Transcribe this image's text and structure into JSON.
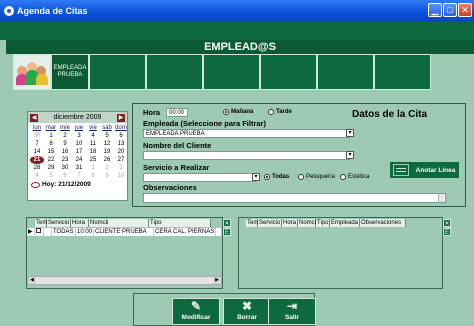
{
  "window": {
    "title": "Agenda de Citas",
    "controls": [
      "minimize",
      "maximize",
      "close"
    ]
  },
  "header": {
    "title": "EMPLEAD@S"
  },
  "thumbs": [
    {
      "kind": "people-icon"
    },
    {
      "label": "EMPLEADA PRUEBA"
    }
  ],
  "calendar": {
    "month": "diciembre 2009",
    "days_of_week": [
      "lun",
      "mar",
      "mié",
      "jue",
      "vie",
      "sáb",
      "dom"
    ],
    "weeks": [
      [
        "30",
        "1",
        "2",
        "3",
        "4",
        "5",
        "6"
      ],
      [
        "7",
        "8",
        "9",
        "10",
        "11",
        "12",
        "13"
      ],
      [
        "14",
        "15",
        "16",
        "17",
        "18",
        "19",
        "20"
      ],
      [
        "21",
        "22",
        "23",
        "24",
        "25",
        "26",
        "27"
      ],
      [
        "28",
        "29",
        "30",
        "31",
        "1",
        "2",
        "3"
      ],
      [
        "4",
        "5",
        "6",
        "7",
        "8",
        "9",
        "10"
      ]
    ],
    "selected_day": "21",
    "today_label": "Hoy: 21/12/2009"
  },
  "form": {
    "hora_label": "Hora",
    "hora_value": "00:00",
    "manana_label": "Mañana",
    "tarde_label": "Tarde",
    "section_title": "Datos de la Cita",
    "empleada_label": "Empleada (Seleccione para Filtrar)",
    "empleada_value": "EMPLEADA PRUEBA",
    "cliente_label": "Nombre del Cliente",
    "cliente_value": "",
    "servicio_label": "Servicio a Realizar",
    "servicio_value": "",
    "todas_label": "Todas",
    "peluqueria_label": "Peluquería",
    "estetica_label": "Estética",
    "observaciones_label": "Observaciones",
    "observaciones_value": "",
    "anotar_label": "Anotar Línea"
  },
  "left_grid": {
    "columns": [
      "Tem",
      "Servicio",
      "Hora",
      "Nomcli",
      "Tipo"
    ],
    "rows": [
      [
        "",
        "TODAS",
        "10:00",
        "CLIENTE PRUEBA",
        "CERA CAL. PIERNAS"
      ]
    ]
  },
  "right_grid": {
    "columns": [
      "Tem",
      "Servicio",
      "Hora",
      "Nomcli",
      "Tipo",
      "Empleada",
      "Observaciones"
    ]
  },
  "actions": {
    "modificar": "Modificar",
    "borrar": "Borrar",
    "salir": "Salir"
  }
}
